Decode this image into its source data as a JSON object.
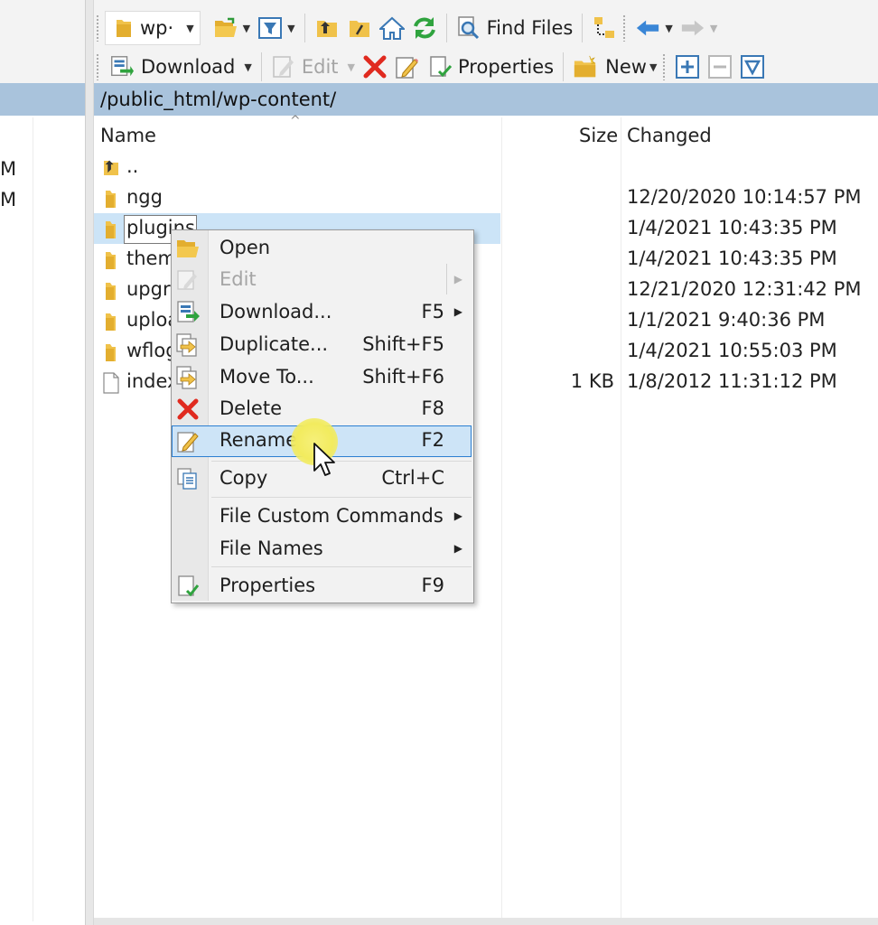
{
  "left_pane": {
    "fragments": [
      "M",
      "M"
    ]
  },
  "toolbar": {
    "drive_label": "wp·",
    "find_files_label": "Find Files",
    "download_label": "Download",
    "edit_label": "Edit",
    "properties_label": "Properties",
    "new_label": "New"
  },
  "path_bar": {
    "path": "/public_html/wp-content/"
  },
  "file_list": {
    "columns": {
      "name": "Name",
      "size": "Size",
      "changed": "Changed"
    },
    "rows": [
      {
        "name": "..",
        "size": "",
        "changed": "",
        "icon": "parent-dir-icon"
      },
      {
        "name": "ngg",
        "size": "",
        "changed": "12/20/2020 10:14:57 PM",
        "icon": "folder-icon"
      },
      {
        "name": "plugins",
        "size": "",
        "changed": "1/4/2021 10:43:35 PM",
        "icon": "folder-icon"
      },
      {
        "name": "them",
        "size": "",
        "changed": "1/4/2021 10:43:35 PM",
        "icon": "folder-icon"
      },
      {
        "name": "upgra",
        "size": "",
        "changed": "12/21/2020 12:31:42 PM",
        "icon": "folder-icon"
      },
      {
        "name": "uploa",
        "size": "",
        "changed": "1/1/2021 9:40:36 PM",
        "icon": "folder-icon"
      },
      {
        "name": "wflog",
        "size": "",
        "changed": "1/4/2021 10:55:03 PM",
        "icon": "folder-icon"
      },
      {
        "name": "index",
        "size": "1 KB",
        "changed": "1/8/2012 11:31:12 PM",
        "icon": "file-icon"
      }
    ]
  },
  "context_menu": {
    "items": [
      {
        "label": "Open",
        "shortcut": "",
        "submenu": false,
        "disabled": false,
        "icon": "open-folder-icon"
      },
      {
        "label": "Edit",
        "shortcut": "",
        "submenu": true,
        "disabled": true,
        "icon": "edit-icon"
      },
      {
        "label": "Download...",
        "shortcut": "F5",
        "submenu": true,
        "disabled": false,
        "icon": "download-icon"
      },
      {
        "label": "Duplicate...",
        "shortcut": "Shift+F5",
        "submenu": false,
        "disabled": false,
        "icon": "duplicate-icon"
      },
      {
        "label": "Move To...",
        "shortcut": "Shift+F6",
        "submenu": false,
        "disabled": false,
        "icon": "move-icon"
      },
      {
        "label": "Delete",
        "shortcut": "F8",
        "submenu": false,
        "disabled": false,
        "icon": "delete-icon"
      },
      {
        "label": "Rename",
        "shortcut": "F2",
        "submenu": false,
        "disabled": false,
        "highlighted": true,
        "icon": "rename-icon"
      },
      {
        "label": "Copy",
        "shortcut": "Ctrl+C",
        "submenu": false,
        "disabled": false,
        "icon": "copy-icon"
      },
      {
        "label": "File Custom Commands",
        "shortcut": "",
        "submenu": true,
        "disabled": false,
        "icon": ""
      },
      {
        "label": "File Names",
        "shortcut": "",
        "submenu": true,
        "disabled": false,
        "icon": ""
      },
      {
        "label": "Properties",
        "shortcut": "F9",
        "submenu": false,
        "disabled": false,
        "icon": "properties-icon"
      }
    ]
  },
  "colors": {
    "path_bar": "#a9c3dc",
    "selection": "#cce4f7",
    "menu_highlight_border": "#2c7fd1",
    "folder": "#f0c24a",
    "delete_red": "#e02a1f"
  }
}
